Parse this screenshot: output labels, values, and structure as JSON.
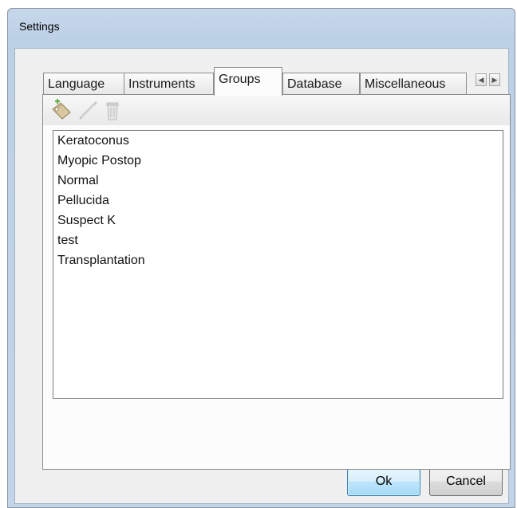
{
  "window": {
    "title": "Settings"
  },
  "tabs": [
    {
      "label": "Language"
    },
    {
      "label": "Instruments"
    },
    {
      "label": "Groups"
    },
    {
      "label": "Database"
    },
    {
      "label": "Miscellaneous"
    }
  ],
  "active_tab": "Groups",
  "tab_scroll": {
    "left_icon": "scroll-left-icon",
    "right_icon": "scroll-right-icon"
  },
  "toolbar": {
    "icons": [
      "add-group-icon",
      "edit-pencil-icon",
      "delete-trash-icon"
    ]
  },
  "groups": [
    {
      "label": "Keratoconus"
    },
    {
      "label": "Myopic Postop"
    },
    {
      "label": "Normal"
    },
    {
      "label": "Pellucida"
    },
    {
      "label": "Suspect K"
    },
    {
      "label": "test"
    },
    {
      "label": "Transplantation"
    }
  ],
  "buttons": {
    "ok": "Ok",
    "cancel": "Cancel"
  },
  "colors": {
    "title_bar": "#c2d4e8",
    "default_button": "#bde6fd"
  }
}
